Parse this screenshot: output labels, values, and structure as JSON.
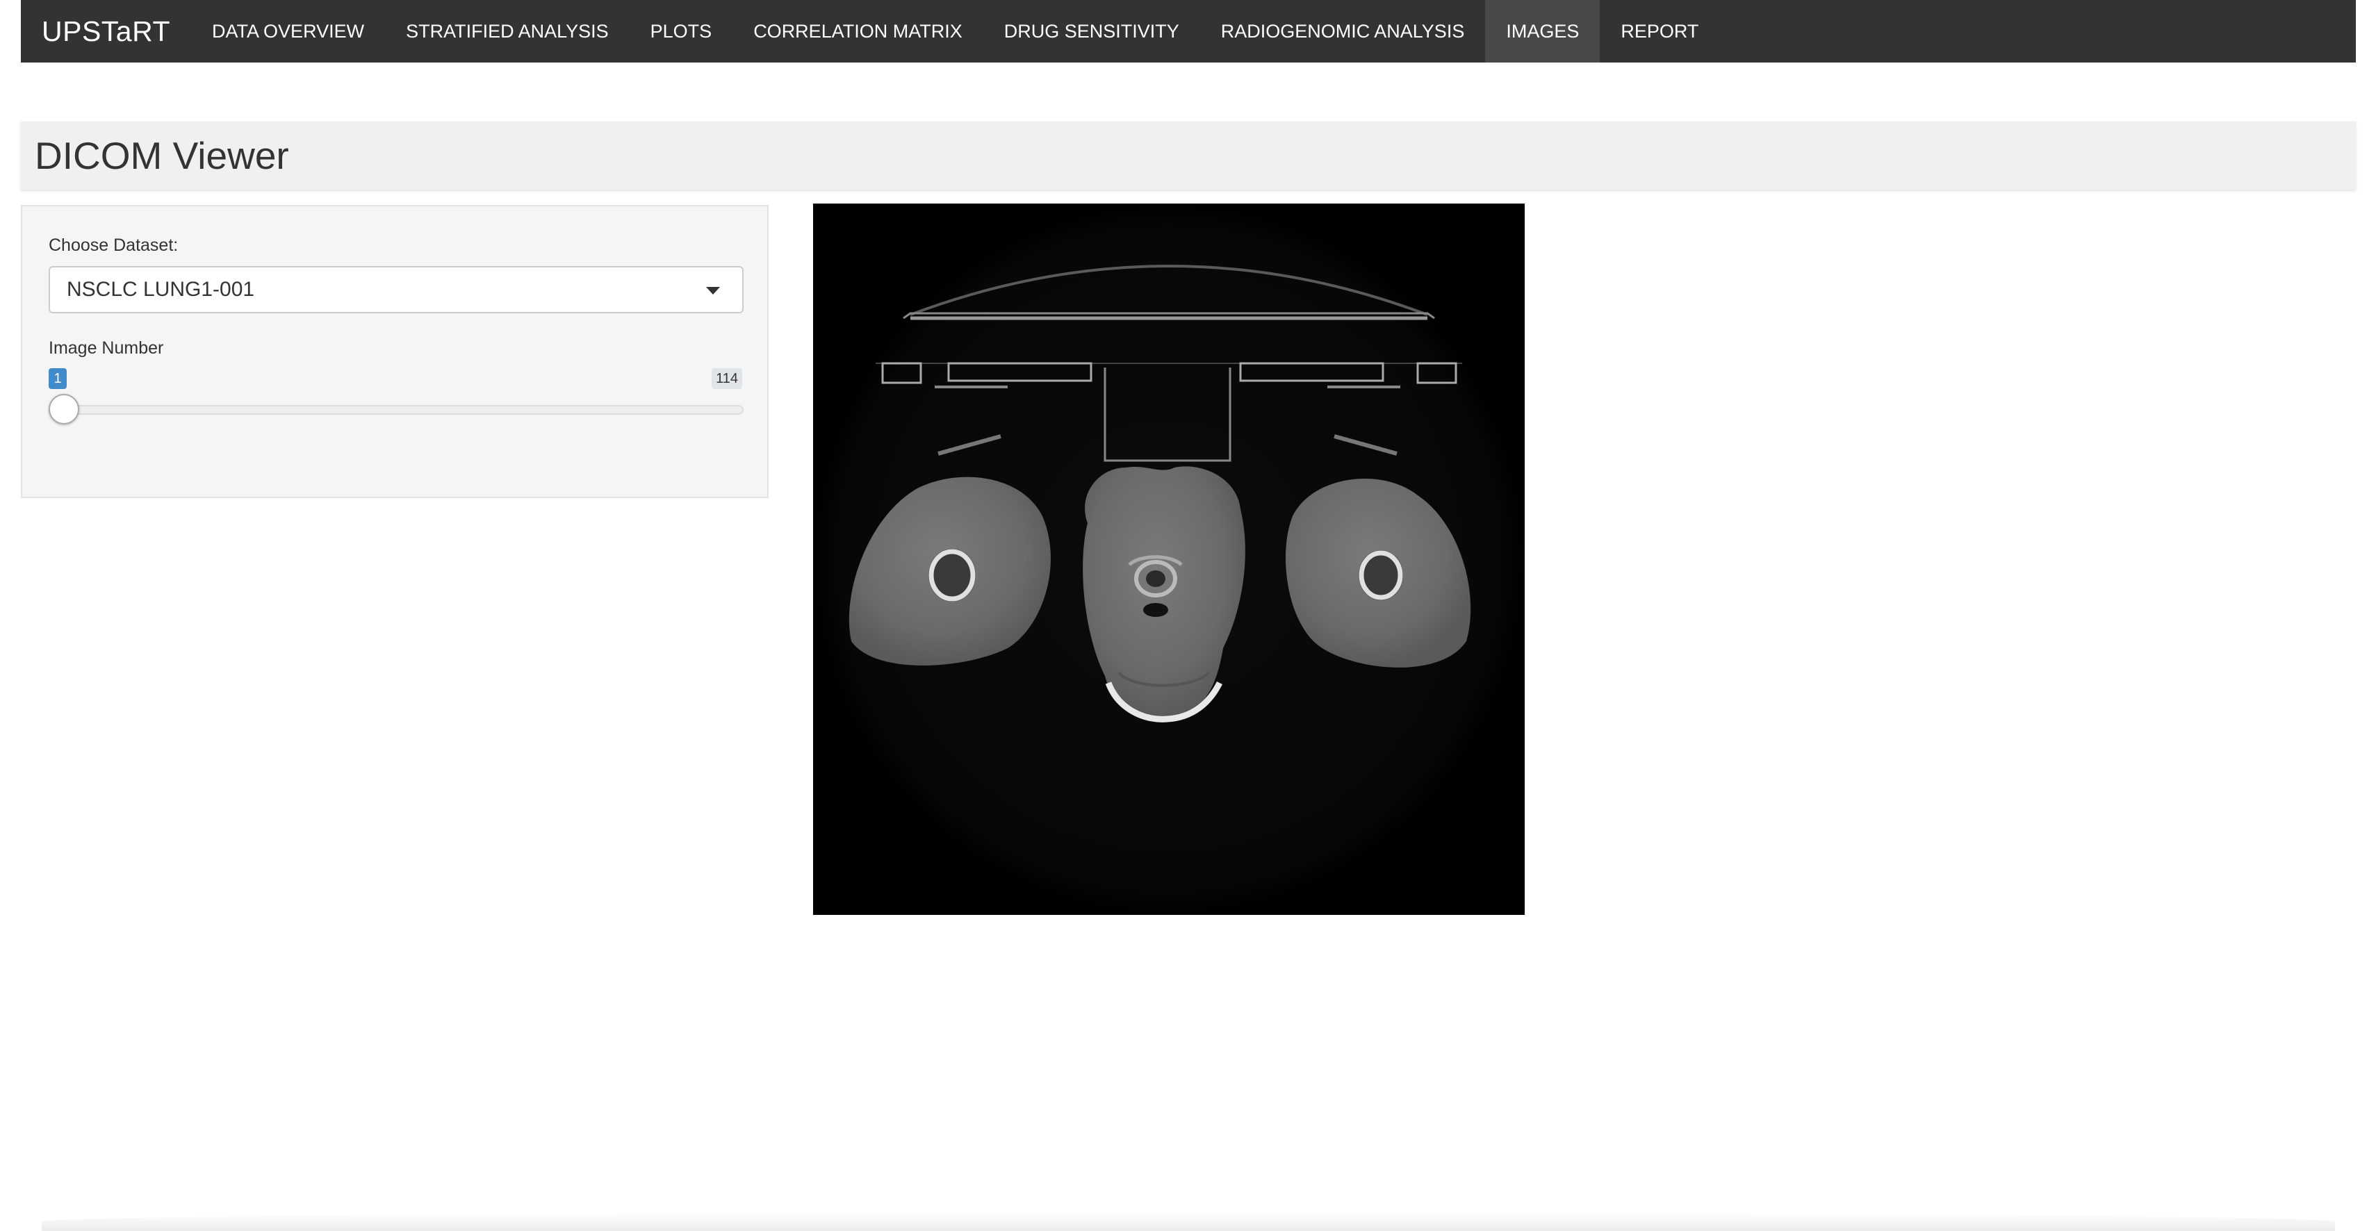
{
  "app": {
    "brand": "UPSTaRT"
  },
  "nav": {
    "tabs": [
      {
        "label": "DATA OVERVIEW"
      },
      {
        "label": "STRATIFIED ANALYSIS"
      },
      {
        "label": "PLOTS"
      },
      {
        "label": "CORRELATION MATRIX"
      },
      {
        "label": "DRUG SENSITIVITY"
      },
      {
        "label": "RADIOGENOMIC ANALYSIS"
      },
      {
        "label": "IMAGES"
      },
      {
        "label": "REPORT"
      }
    ],
    "active_tab": "IMAGES"
  },
  "page": {
    "title": "DICOM Viewer"
  },
  "sidebar": {
    "dataset_label": "Choose Dataset:",
    "dataset_value": "NSCLC LUNG1-001",
    "slider_label": "Image Number",
    "slider_min": "1",
    "slider_max": "114",
    "slider_value": "1"
  },
  "viewer": {
    "image_icon": "ct-scan-image"
  },
  "colors": {
    "navbar_bg": "#333333",
    "navbar_active": "#484848",
    "slider_accent": "#428bca"
  }
}
